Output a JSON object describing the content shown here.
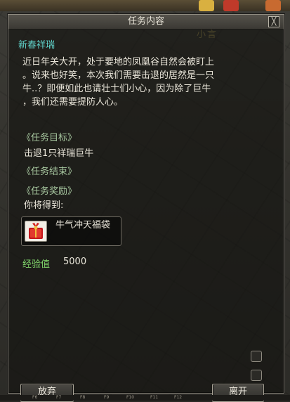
{
  "window": {
    "title": "任务内容",
    "close_symbol": "╳"
  },
  "scene": {
    "background_sign": "小言"
  },
  "quest": {
    "name": "新春祥瑞",
    "description": "近日年关大开，处于要地的凤凰谷自然会被盯上\n。说来也好笑，本次我们需要击退的居然是一只\n牛..？即便如此也请壮士们小心，因为除了巨牛\n，我们还需要提防人心。",
    "objective_header": "《任务目标》",
    "objective": "击退1只祥瑞巨牛",
    "end_header": "《任务结束》",
    "reward_header": "《任务奖励》",
    "receive_label": "你将得到:",
    "reward_item": {
      "name": "牛气冲天福袋",
      "icon": "red-gift-bag-icon"
    },
    "exp_label": "经验值",
    "exp_value": "5000"
  },
  "buttons": {
    "abandon": "放弃",
    "leave": "离开"
  },
  "hotkeys": [
    "F6",
    "F7",
    "F8",
    "F9",
    "F10",
    "F11",
    "F12"
  ],
  "colors": {
    "quest_name": "#5fd0c8",
    "section_header": "#a8c8a0",
    "exp_label": "#7fd36a",
    "body_text": "#eae6da"
  }
}
